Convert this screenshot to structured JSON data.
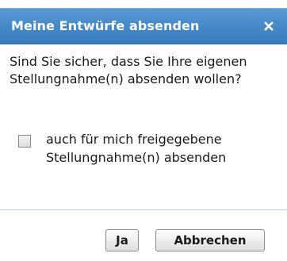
{
  "dialog": {
    "title": "Meine Entwürfe absenden",
    "close_icon": "close-icon",
    "question": "Sind Sie sicher, dass Sie Ihre eigenen Stellungnahme(n) absenden wollen?",
    "checkbox": {
      "label": "auch für mich freigegebene Stellungnahme(n) absenden",
      "checked": false
    },
    "buttons": {
      "yes_label": "Ja",
      "cancel_label": "Abbrechen"
    },
    "colors": {
      "titlebar": "#4589c7",
      "title_text": "#ffffff",
      "divider": "#b9cfe4"
    }
  }
}
